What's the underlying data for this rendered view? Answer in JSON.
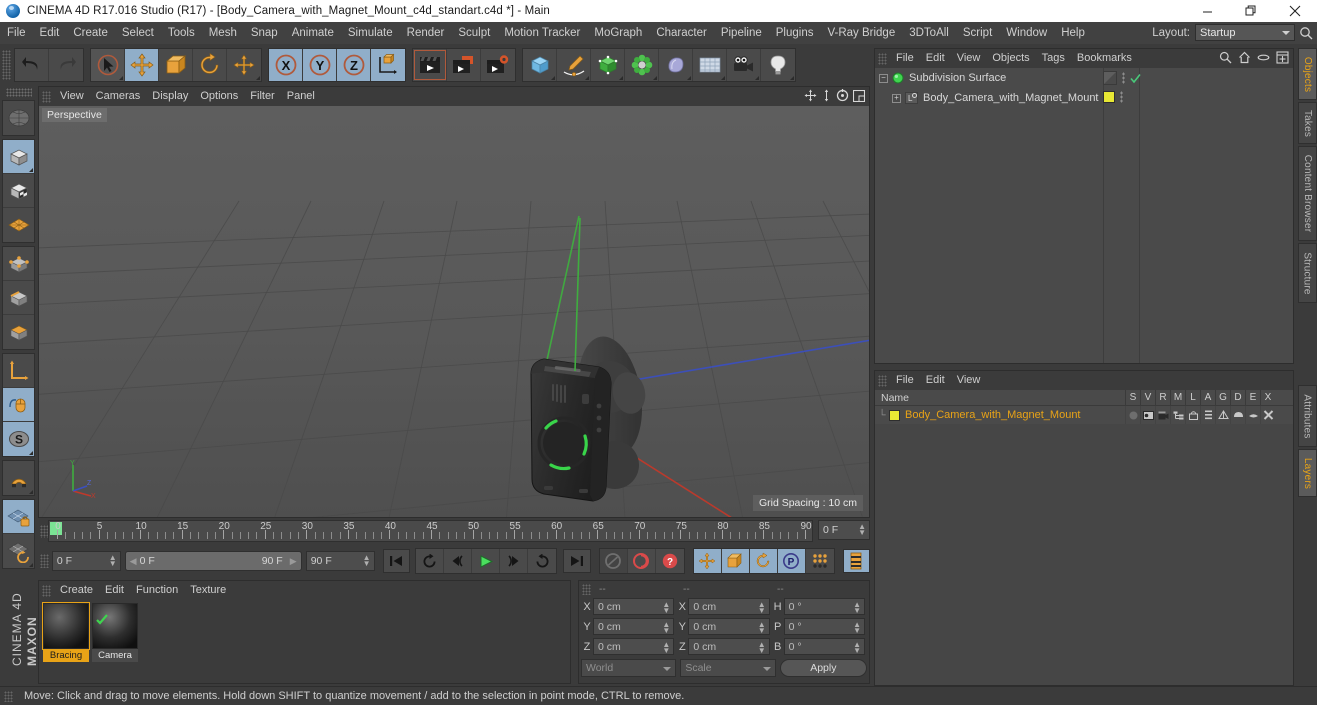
{
  "window": {
    "title": "CINEMA 4D R17.016 Studio (R17) - [Body_Camera_with_Magnet_Mount_c4d_standart.c4d *] - Main",
    "minimize": "minimize-icon",
    "restore": "restore-icon",
    "close": "close-icon"
  },
  "menubar": {
    "items": [
      "File",
      "Edit",
      "Create",
      "Select",
      "Tools",
      "Mesh",
      "Snap",
      "Animate",
      "Simulate",
      "Render",
      "Sculpt",
      "Motion Tracker",
      "MoGraph",
      "Character",
      "Pipeline",
      "Plugins",
      "V-Ray Bridge",
      "3DToAll",
      "Script",
      "Window",
      "Help"
    ],
    "layout_label": "Layout:",
    "layout_value": "Startup",
    "search_icon": "search-icon"
  },
  "toolbar": {
    "groups": [
      {
        "name": "history",
        "buttons": [
          {
            "icon": "undo-icon",
            "state": "dark"
          },
          {
            "icon": "redo-icon",
            "state": "disabled"
          }
        ]
      },
      {
        "name": "transform",
        "buttons": [
          {
            "icon": "select-live-icon",
            "state": "dark"
          },
          {
            "icon": "move-icon",
            "state": "on"
          },
          {
            "icon": "scale-icon",
            "state": "dark"
          },
          {
            "icon": "rotate-icon",
            "state": "dark"
          },
          {
            "icon": "move-axis-icon",
            "state": "dark"
          }
        ]
      },
      {
        "name": "axis-lock",
        "buttons": [
          {
            "icon": "x-axis-icon",
            "state": "on"
          },
          {
            "icon": "y-axis-icon",
            "state": "on"
          },
          {
            "icon": "z-axis-icon",
            "state": "on"
          },
          {
            "icon": "world-object-coord-icon",
            "state": "on"
          }
        ]
      },
      {
        "name": "render",
        "buttons": [
          {
            "icon": "render-view-icon",
            "state": "dark"
          },
          {
            "icon": "render-region-icon",
            "state": "dark"
          },
          {
            "icon": "render-settings-icon",
            "state": "dark"
          }
        ]
      },
      {
        "name": "create",
        "buttons": [
          {
            "icon": "cube-primitive-icon",
            "state": "dark"
          },
          {
            "icon": "spline-pen-icon",
            "state": "dark"
          },
          {
            "icon": "generator-icon",
            "state": "dark"
          },
          {
            "icon": "deformer-icon",
            "state": "dark"
          },
          {
            "icon": "scene-object-icon",
            "state": "dark"
          },
          {
            "icon": "floor-icon",
            "state": "dark"
          },
          {
            "icon": "camera-icon",
            "state": "dark"
          },
          {
            "icon": "light-icon",
            "state": "dark"
          }
        ]
      }
    ]
  },
  "lefttoolbar": {
    "buttons": [
      {
        "icon": "make-editable-icon",
        "state": "dark"
      },
      {
        "icon": "model-mode-icon",
        "state": "on"
      },
      {
        "icon": "texture-mode-icon",
        "state": "dark"
      },
      {
        "icon": "workplane-mode-icon",
        "state": "dark"
      },
      {
        "icon": "points-mode-icon",
        "state": "dark"
      },
      {
        "icon": "edges-mode-icon",
        "state": "dark"
      },
      {
        "icon": "polygons-mode-icon",
        "state": "dark"
      },
      {
        "icon": "object-axis-icon",
        "state": "dark"
      },
      {
        "icon": "enable-axis-icon",
        "state": "on"
      },
      {
        "icon": "enable-snap-icon",
        "state": "on"
      },
      {
        "icon": "magnet-snap-icon",
        "state": "dark"
      },
      {
        "icon": "lock-workplane-icon",
        "state": "on"
      },
      {
        "icon": "workplane-rotate-icon",
        "state": "dark"
      }
    ],
    "brand_top": "MAXON",
    "brand_bottom": "CINEMA 4D"
  },
  "viewport": {
    "menu": [
      "View",
      "Cameras",
      "Display",
      "Options",
      "Filter",
      "Panel"
    ],
    "icons": [
      "pan-icon",
      "zoom-icon",
      "rotate-view-icon",
      "maximize-view-icon"
    ],
    "label": "Perspective",
    "grid_spacing": "Grid Spacing : 10 cm",
    "axis_labels": {
      "x": "X",
      "y": "Y",
      "z": "Z"
    },
    "colors": {
      "x_axis": "#c0392b",
      "y_axis": "#3fae3f",
      "z_axis": "#3b4fbf",
      "selection": "#39d54a",
      "background": "#5b5b5b"
    }
  },
  "timeline": {
    "ticks": [
      0,
      5,
      10,
      15,
      20,
      25,
      30,
      35,
      40,
      45,
      50,
      55,
      60,
      65,
      70,
      75,
      80,
      85,
      90
    ],
    "min": 0,
    "max": 90,
    "current_frame_field": "0 F"
  },
  "animbar": {
    "start_field": "0 F",
    "range_start": "0 F",
    "range_end": "90 F",
    "end_field": "90 F",
    "buttons": [
      {
        "icon": "go-to-start-icon"
      },
      {
        "icon": "rewind-icon"
      },
      {
        "icon": "step-back-icon"
      },
      {
        "icon": "play-icon"
      },
      {
        "icon": "step-forward-icon"
      },
      {
        "icon": "loop-icon"
      },
      {
        "icon": "go-to-end-icon"
      },
      {
        "icon": "autokey-icon"
      },
      {
        "icon": "record-icon"
      },
      {
        "icon": "keyframe-selection-icon"
      },
      {
        "icon": "key-position-icon"
      },
      {
        "icon": "key-scale-icon"
      },
      {
        "icon": "key-rotation-icon"
      },
      {
        "icon": "key-param-icon"
      },
      {
        "icon": "key-pla-icon"
      },
      {
        "icon": "timeline-icon"
      }
    ]
  },
  "material_manager": {
    "menu": [
      "Create",
      "Edit",
      "Function",
      "Texture"
    ],
    "materials": [
      {
        "name": "Bracing",
        "selected": true
      },
      {
        "name": "Camera",
        "selected": false
      }
    ]
  },
  "coordinates": {
    "headers": [
      "--",
      "--",
      "--"
    ],
    "position": {
      "label_x": "X",
      "label_y": "Y",
      "label_z": "Z",
      "x": "0 cm",
      "y": "0 cm",
      "z": "0 cm"
    },
    "size": {
      "label_x": "X",
      "label_y": "Y",
      "label_z": "Z",
      "x": "0 cm",
      "y": "0 cm",
      "z": "0 cm"
    },
    "rotation": {
      "label_h": "H",
      "label_p": "P",
      "label_b": "B",
      "h": "0 °",
      "p": "0 °",
      "b": "0 °"
    },
    "coord_system": "World",
    "size_mode": "Scale",
    "apply_label": "Apply"
  },
  "object_manager": {
    "menu": [
      "File",
      "Edit",
      "View",
      "Objects",
      "Tags",
      "Bookmarks"
    ],
    "icons": [
      "search-icon",
      "home-icon",
      "link-icon",
      "expand-icon"
    ],
    "tree": [
      {
        "name": "Subdivision Surface",
        "icon": "subdivision-surface-icon",
        "depth": 0,
        "visibility_dots": true,
        "check": true
      },
      {
        "name": "Body_Camera_with_Magnet_Mount",
        "icon": "polygon-object-icon",
        "depth": 1,
        "tag_color": "#e8e834"
      }
    ]
  },
  "layer_manager": {
    "menu": [
      "File",
      "Edit",
      "View"
    ],
    "name_header": "Name",
    "columns": [
      "S",
      "V",
      "R",
      "M",
      "L",
      "A",
      "G",
      "D",
      "E",
      "X"
    ],
    "rows": [
      {
        "name": "Body_Camera_with_Magnet_Mount",
        "color": "#e8e834",
        "text_color": "#e8a317"
      }
    ]
  },
  "right_tabs": {
    "top": [
      {
        "label": "Objects",
        "active": true
      },
      {
        "label": "Takes",
        "active": false
      },
      {
        "label": "Content Browser",
        "active": false
      },
      {
        "label": "Structure",
        "active": false
      }
    ],
    "bottom": [
      {
        "label": "Attributes",
        "active": false
      },
      {
        "label": "Layers",
        "active": true
      }
    ]
  },
  "status": {
    "text": "Move: Click and drag to move elements. Hold down SHIFT to quantize movement / add to the selection in point mode, CTRL to remove."
  }
}
